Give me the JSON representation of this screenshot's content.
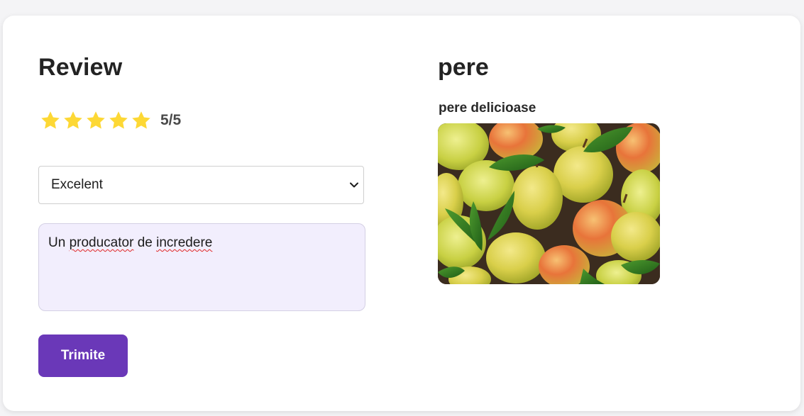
{
  "review": {
    "title": "Review",
    "rating": {
      "value": 5,
      "max": 5,
      "label": "5/5"
    },
    "quality_select": {
      "selected": "Excelent"
    },
    "comment": {
      "prefix": "Un ",
      "word1": "producator",
      "middle": " de ",
      "word2": "incredere"
    },
    "submit_label": "Trimite"
  },
  "product": {
    "name": "pere",
    "description": "pere delicioase",
    "image_icon": "pears-photo"
  },
  "colors": {
    "star": "#fdd835",
    "button": "#6a38b8",
    "textarea_bg": "#f2eefd"
  }
}
